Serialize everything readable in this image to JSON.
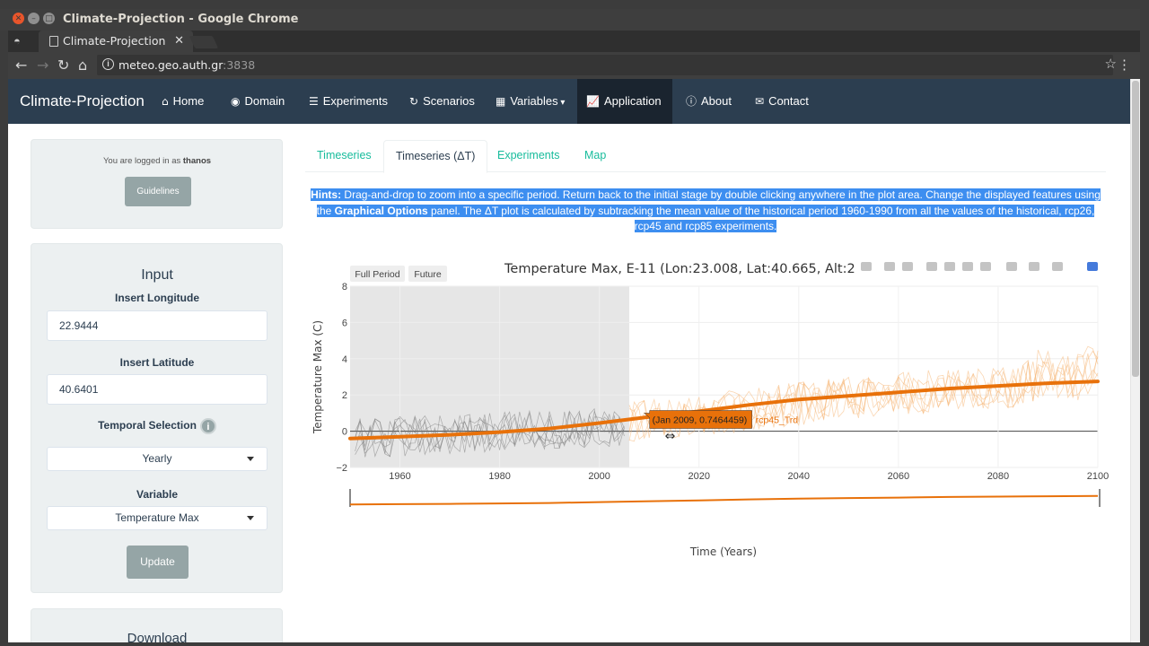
{
  "window": {
    "title": "Climate-Projection - Google Chrome"
  },
  "browser": {
    "tab_title": "Climate-Projection",
    "url_host": "meteo.geo.auth.gr",
    "url_port": ":3838"
  },
  "navbar": {
    "brand": "Climate-Projection",
    "items": [
      {
        "label": "Home",
        "icon": "home-icon",
        "glyph": "⌂"
      },
      {
        "label": "Domain",
        "icon": "globe-icon",
        "glyph": "◉"
      },
      {
        "label": "Experiments",
        "icon": "database-icon",
        "glyph": "☰"
      },
      {
        "label": "Scenarios",
        "icon": "refresh-icon",
        "glyph": "↻"
      },
      {
        "label": "Variables",
        "icon": "grid-icon",
        "glyph": "▦"
      },
      {
        "label": "Application",
        "icon": "line-chart-icon",
        "glyph": "📈"
      },
      {
        "label": "About",
        "icon": "info-icon",
        "glyph": "ⓘ"
      },
      {
        "label": "Contact",
        "icon": "envelope-icon",
        "glyph": "✉"
      }
    ]
  },
  "sidebar": {
    "logged_prefix": "You are logged in as",
    "username": "thanos",
    "guidelines_button": "Guidelines",
    "input_heading": "Input",
    "longitude_label": "Insert Longitude",
    "longitude_value": "22.9444",
    "latitude_label": "Insert Latitude",
    "latitude_value": "40.6401",
    "temporal_label": "Temporal Selection",
    "temporal_value": "Yearly",
    "variable_label": "Variable",
    "variable_value": "Temperature Max",
    "update_button": "Update",
    "download_heading": "Download"
  },
  "tabs": [
    "Timeseries",
    "Timeseries (ΔT)",
    "Experiments",
    "Map"
  ],
  "hints": {
    "bold_prefix": "Hints:",
    "text_1": " Drag-and-drop to zoom into a specific period. Return back to the initial stage by double clicking anywhere in the plot area. Change the displayed features using the ",
    "bold_mid": "Graphical Options",
    "text_2": " panel. The ΔT plot is calculated by subtracking the mean value of the historical period 1960-1990 from all the values of the historical, rcp26, rcp45 and rcp85 experiments."
  },
  "chart_data": {
    "type": "line",
    "title": "Temperature Max, E-11 (Lon:23.008, Lat:40.665, Alt:2",
    "xlabel": "Time (Years)",
    "ylabel": "Temperature Max (C)",
    "xlim": [
      1950,
      2100
    ],
    "ylim": [
      -2,
      8
    ],
    "x_ticks": [
      1960,
      1980,
      2000,
      2020,
      2040,
      2060,
      2080,
      2100
    ],
    "x_tick_labels": [
      "1960",
      "1980",
      "2000",
      "2020",
      "2040",
      "2060",
      "2080",
      "2100"
    ],
    "y_ticks": [
      -2,
      0,
      2,
      4,
      6,
      8
    ],
    "y_tick_labels": [
      "−2",
      "0",
      "2",
      "4",
      "6",
      "8"
    ],
    "range_buttons": [
      "Full Period",
      "Future"
    ],
    "shaded_period": [
      1950,
      2006
    ],
    "series": [
      {
        "name": "rcp45_Trd",
        "color": "#e8710a",
        "x": [
          1950,
          1960,
          1970,
          1980,
          1990,
          2000,
          2009,
          2020,
          2030,
          2040,
          2050,
          2060,
          2070,
          2080,
          2090,
          2100
        ],
        "values": [
          -0.4,
          -0.3,
          -0.2,
          -0.05,
          0.15,
          0.45,
          0.75,
          1.1,
          1.45,
          1.75,
          1.95,
          2.15,
          2.35,
          2.5,
          2.65,
          2.75
        ]
      }
    ],
    "hover": {
      "label": "(Jan 2009, 0.7464459)",
      "series": "rcp45_Trd",
      "x": 2009,
      "y": 0.7464459
    }
  }
}
